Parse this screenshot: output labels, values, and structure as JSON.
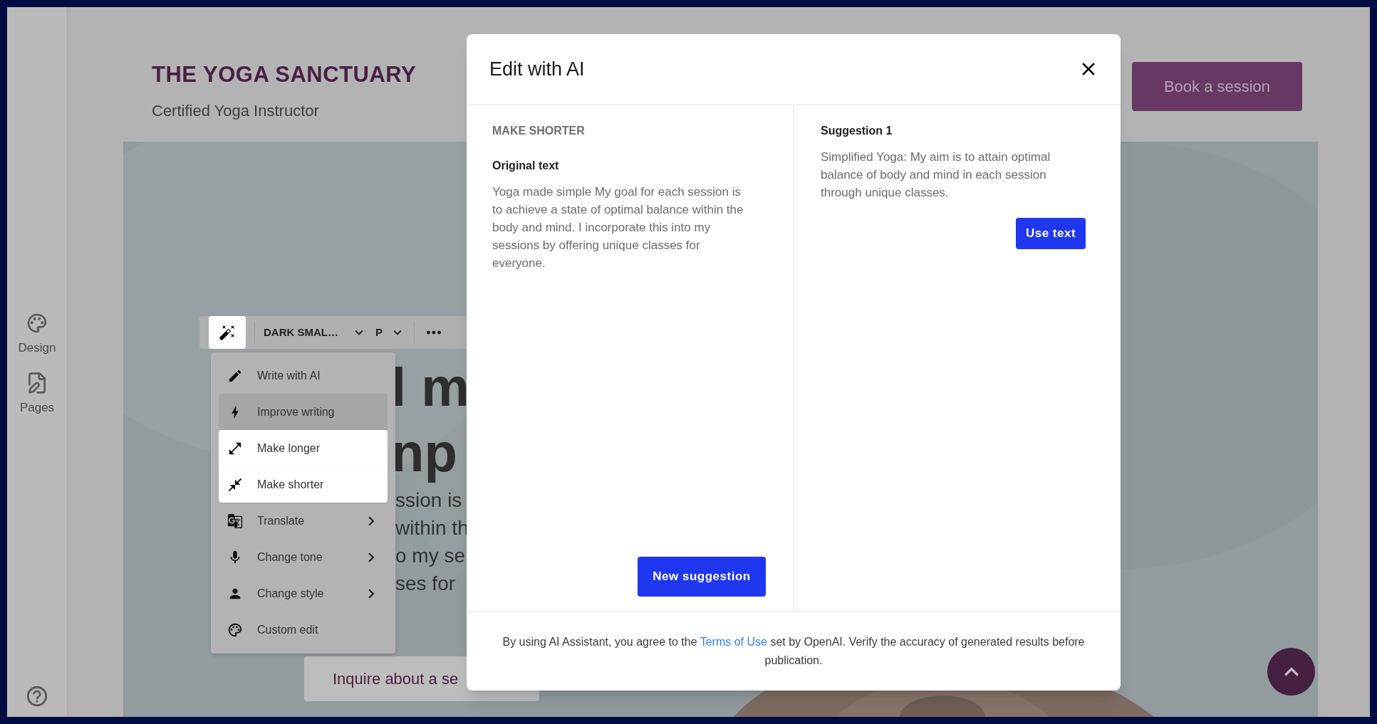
{
  "sidebar": {
    "items": [
      {
        "label": "Design"
      },
      {
        "label": "Pages"
      }
    ]
  },
  "site": {
    "title": "THE YOGA SANCTUARY",
    "subtitle": "Certified Yoga Instructor",
    "book_button": "Book a session"
  },
  "hero": {
    "heading_fragments": [
      "l m",
      "np"
    ],
    "text_fragments": [
      "ssion is",
      "within th",
      "o my se",
      "ses for"
    ],
    "inquire_button": "Inquire about a se"
  },
  "toolbar": {
    "style_select": "DARK SMAL…",
    "tag_select": "P"
  },
  "menu": {
    "items": [
      {
        "label": "Write with AI",
        "hovered": false,
        "featured": false,
        "submenu": false
      },
      {
        "label": "Improve writing",
        "hovered": true,
        "featured": false,
        "submenu": false
      },
      {
        "label": "Make longer",
        "hovered": false,
        "featured": true,
        "submenu": false
      },
      {
        "label": "Make shorter",
        "hovered": false,
        "featured": true,
        "submenu": false
      },
      {
        "label": "Translate",
        "hovered": false,
        "featured": false,
        "submenu": true
      },
      {
        "label": "Change tone",
        "hovered": false,
        "featured": false,
        "submenu": true
      },
      {
        "label": "Change style",
        "hovered": false,
        "featured": false,
        "submenu": true
      },
      {
        "label": "Custom edit",
        "hovered": false,
        "featured": false,
        "submenu": false
      }
    ]
  },
  "modal": {
    "title": "Edit with AI",
    "mode": "MAKE SHORTER",
    "original_label": "Original text",
    "original_text": "Yoga made simple My goal for each session is to achieve a state of optimal balance within the body and mind. I incorporate this into my sessions by offering unique classes for everyone.",
    "new_button": "New suggestion",
    "suggestions": [
      {
        "title": "Suggestion 1",
        "text": "Simplified Yoga: My aim is to attain optimal balance of body and mind in each session through unique classes.",
        "button": "Use text"
      }
    ],
    "footer": {
      "before": "By using AI Assistant, you agree to the ",
      "link": "Terms of Use",
      "after": " set by OpenAI. Verify the accuracy of generated results before publication."
    }
  }
}
